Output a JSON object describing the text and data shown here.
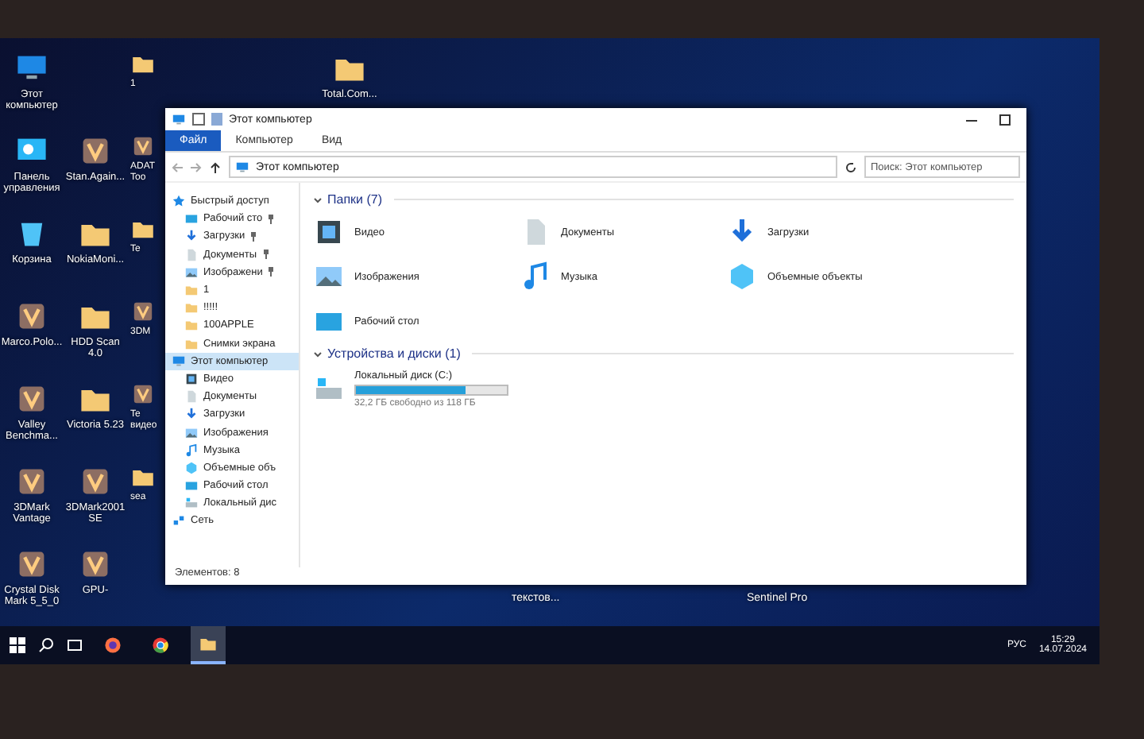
{
  "desktop": {
    "icons": [
      {
        "label": "Этот компьютер",
        "kind": "computer"
      },
      {
        "label": "Панель управления",
        "kind": "panel"
      },
      {
        "label": "Корзина",
        "kind": "bin"
      },
      {
        "label": "Marco.Polo...",
        "kind": "app"
      },
      {
        "label": "Valley Benchma...",
        "kind": "app"
      },
      {
        "label": "3DMark Vantage",
        "kind": "app"
      },
      {
        "label": "Crystal Disk Mark 5_5_0",
        "kind": "app"
      },
      {
        "label": "Stan.Again...",
        "kind": "app"
      },
      {
        "label": "NokiaMoni...",
        "kind": "folder"
      },
      {
        "label": "HDD Scan 4.0",
        "kind": "folder"
      },
      {
        "label": "Victoria 5.23",
        "kind": "folder"
      },
      {
        "label": "3DMark2001 SE",
        "kind": "app"
      },
      {
        "label": "GPU-",
        "kind": "app"
      },
      {
        "label": "1",
        "kind": "folder"
      },
      {
        "label": "ADAT Too",
        "kind": "app"
      },
      {
        "label": "Te",
        "kind": "folder"
      },
      {
        "label": "3DM",
        "kind": "app"
      },
      {
        "label": "Te видео",
        "kind": "app"
      },
      {
        "label": "sea",
        "kind": "folder"
      },
      {
        "label": "Total.Com...",
        "kind": "folder"
      },
      {
        "label": "текстов...",
        "kind": "hidden"
      },
      {
        "label": "Sentinel Pro",
        "kind": "hidden"
      }
    ]
  },
  "window": {
    "title": "Этот компьютер",
    "ribbon_tabs": [
      {
        "label": "Файл",
        "selected": true
      },
      {
        "label": "Компьютер",
        "selected": false
      },
      {
        "label": "Вид",
        "selected": false
      }
    ],
    "address": "Этот компьютер",
    "search": {
      "placeholder": "Поиск: Этот компьютер"
    },
    "sidebar": [
      {
        "label": "Быстрый доступ",
        "kind": "star",
        "selected": false,
        "children": [
          {
            "label": "Рабочий сто",
            "kind": "desktop",
            "pinned": true,
            "selected": false
          },
          {
            "label": "Загрузки",
            "kind": "download",
            "pinned": true,
            "selected": false
          },
          {
            "label": "Документы",
            "kind": "docs",
            "pinned": true,
            "selected": false
          },
          {
            "label": "Изображени",
            "kind": "pictures",
            "pinned": true,
            "selected": false
          },
          {
            "label": "1",
            "kind": "folder",
            "pinned": false,
            "selected": false
          },
          {
            "label": "!!!!!",
            "kind": "folder",
            "pinned": false,
            "selected": false
          },
          {
            "label": "100APPLE",
            "kind": "folder",
            "pinned": false,
            "selected": false
          },
          {
            "label": "Снимки экрана",
            "kind": "folder",
            "pinned": false,
            "selected": false
          }
        ]
      },
      {
        "label": "Этот компьютер",
        "kind": "computer",
        "selected": true,
        "children": [
          {
            "label": "Видео",
            "kind": "video",
            "pinned": false,
            "selected": false
          },
          {
            "label": "Документы",
            "kind": "docs",
            "pinned": false,
            "selected": false
          },
          {
            "label": "Загрузки",
            "kind": "download",
            "pinned": false,
            "selected": false
          },
          {
            "label": "Изображения",
            "kind": "pictures",
            "pinned": false,
            "selected": false
          },
          {
            "label": "Музыка",
            "kind": "music",
            "pinned": false,
            "selected": false
          },
          {
            "label": "Объемные объ",
            "kind": "cube",
            "pinned": false,
            "selected": false
          },
          {
            "label": "Рабочий стол",
            "kind": "desktop",
            "pinned": false,
            "selected": false
          },
          {
            "label": "Локальный дис",
            "kind": "drive",
            "pinned": false,
            "selected": false
          }
        ]
      },
      {
        "label": "Сеть",
        "kind": "network",
        "selected": false
      }
    ],
    "sections": [
      {
        "title": "Папки (7)",
        "expanded": true,
        "items": [
          {
            "label": "Видео",
            "kind": "video"
          },
          {
            "label": "Документы",
            "kind": "docs"
          },
          {
            "label": "Загрузки",
            "kind": "download"
          },
          {
            "label": "Изображения",
            "kind": "pictures"
          },
          {
            "label": "Музыка",
            "kind": "music"
          },
          {
            "label": "Объемные объекты",
            "kind": "cube"
          },
          {
            "label": "Рабочий стол",
            "kind": "desktop"
          }
        ]
      },
      {
        "title": "Устройства и диски (1)",
        "expanded": true,
        "drives": [
          {
            "label": "Локальный диск (C:)",
            "level": 0.73,
            "free": "32,2 ГБ свободно из 118 ГБ"
          }
        ]
      }
    ],
    "status_bar": "Элементов: 8"
  },
  "taskbar": {
    "apps": [
      {
        "kind": "firefox",
        "selected": false
      },
      {
        "kind": "chrome",
        "selected": false
      },
      {
        "kind": "explorer",
        "selected": true
      }
    ],
    "language": "РУС",
    "time": "15:29",
    "date": "14.07.2024"
  }
}
